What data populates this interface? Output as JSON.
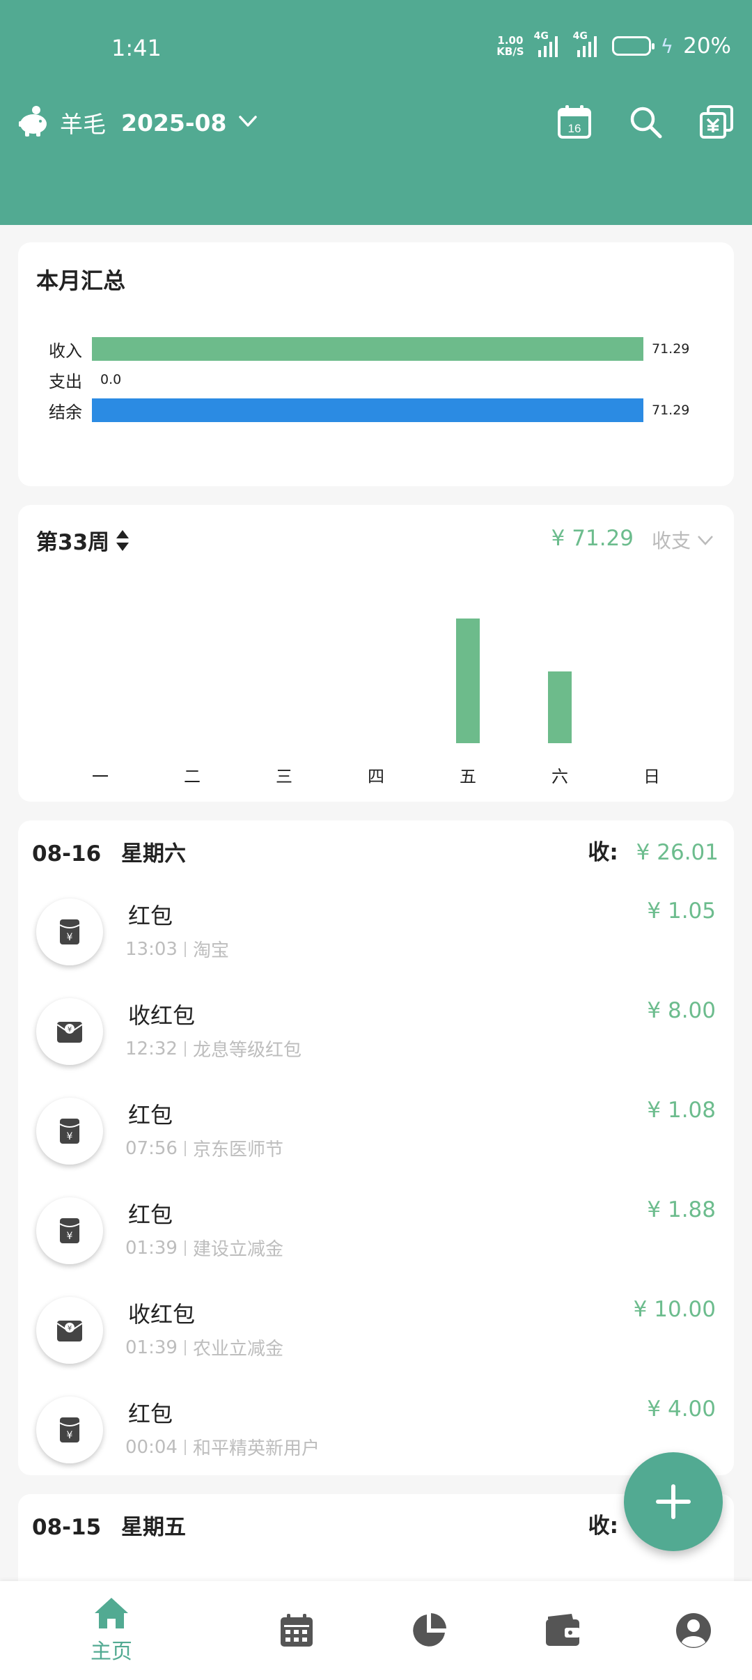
{
  "status_bar": {
    "time": "1:41",
    "net_speed_top": "1.00",
    "net_speed_bottom": "KB/S",
    "signal1_label": "4G",
    "signal2_label": "4G",
    "battery_text": "20%"
  },
  "toolbar": {
    "ledger_name": "羊毛",
    "month": "2025-08",
    "calendar_day": "16",
    "icons": [
      "piggy-bank-icon",
      "chevron-down-icon",
      "calendar-icon",
      "search-icon",
      "currency-copy-icon"
    ]
  },
  "summary": {
    "title": "本月汇总",
    "rows": [
      {
        "label": "收入",
        "value": 71.29,
        "value_text": "71.29",
        "color": "#6dbb8b"
      },
      {
        "label": "支出",
        "value": 0.0,
        "value_text": "0.0",
        "color": "#e57373"
      },
      {
        "label": "结余",
        "value": 71.29,
        "value_text": "71.29",
        "color": "#2b8be3"
      }
    ],
    "max_value": 71.29
  },
  "week": {
    "title": "第33周",
    "amount": "¥ 71.29",
    "filter_label": "收支",
    "chart_data": {
      "type": "bar",
      "categories": [
        "一",
        "二",
        "三",
        "四",
        "五",
        "六",
        "日"
      ],
      "values": [
        0,
        0,
        0,
        0,
        45.28,
        26.01,
        0
      ],
      "ylim": [
        0,
        48
      ],
      "color": "#6dbb8b"
    }
  },
  "day_groups": [
    {
      "date": "08-16",
      "weekday": "星期六",
      "sum_label": "收:",
      "sum_value": "¥ 26.01",
      "items": [
        {
          "title": "红包",
          "time": "13:03",
          "note": "淘宝",
          "amount": "¥ 1.05",
          "icon": "red-packet-icon"
        },
        {
          "title": "收红包",
          "time": "12:32",
          "note": "龙息等级红包",
          "amount": "¥ 8.00",
          "icon": "receive-red-packet-icon"
        },
        {
          "title": "红包",
          "time": "07:56",
          "note": "京东医师节",
          "amount": "¥ 1.08",
          "icon": "red-packet-icon"
        },
        {
          "title": "红包",
          "time": "01:39",
          "note": "建设立减金",
          "amount": "¥ 1.88",
          "icon": "red-packet-icon"
        },
        {
          "title": "收红包",
          "time": "01:39",
          "note": "农业立减金",
          "amount": "¥ 10.00",
          "icon": "receive-red-packet-icon"
        },
        {
          "title": "红包",
          "time": "00:04",
          "note": "和平精英新用户",
          "amount": "¥ 4.00",
          "icon": "red-packet-icon"
        }
      ]
    },
    {
      "date": "08-15",
      "weekday": "星期五",
      "sum_label": "收:"
    }
  ],
  "bottom_nav": {
    "items": [
      {
        "label": "主页",
        "icon": "home-icon",
        "active": true
      },
      {
        "label": "",
        "icon": "calendar-grid-icon",
        "active": false
      },
      {
        "label": "",
        "icon": "pie-chart-icon",
        "active": false
      },
      {
        "label": "",
        "icon": "wallet-icon",
        "active": false
      },
      {
        "label": "",
        "icon": "profile-icon",
        "active": false
      }
    ]
  },
  "colors": {
    "primary": "#52aa92",
    "income_green": "#6cbc8d",
    "balance_blue": "#2b8be3",
    "icon_dark": "#444444"
  }
}
